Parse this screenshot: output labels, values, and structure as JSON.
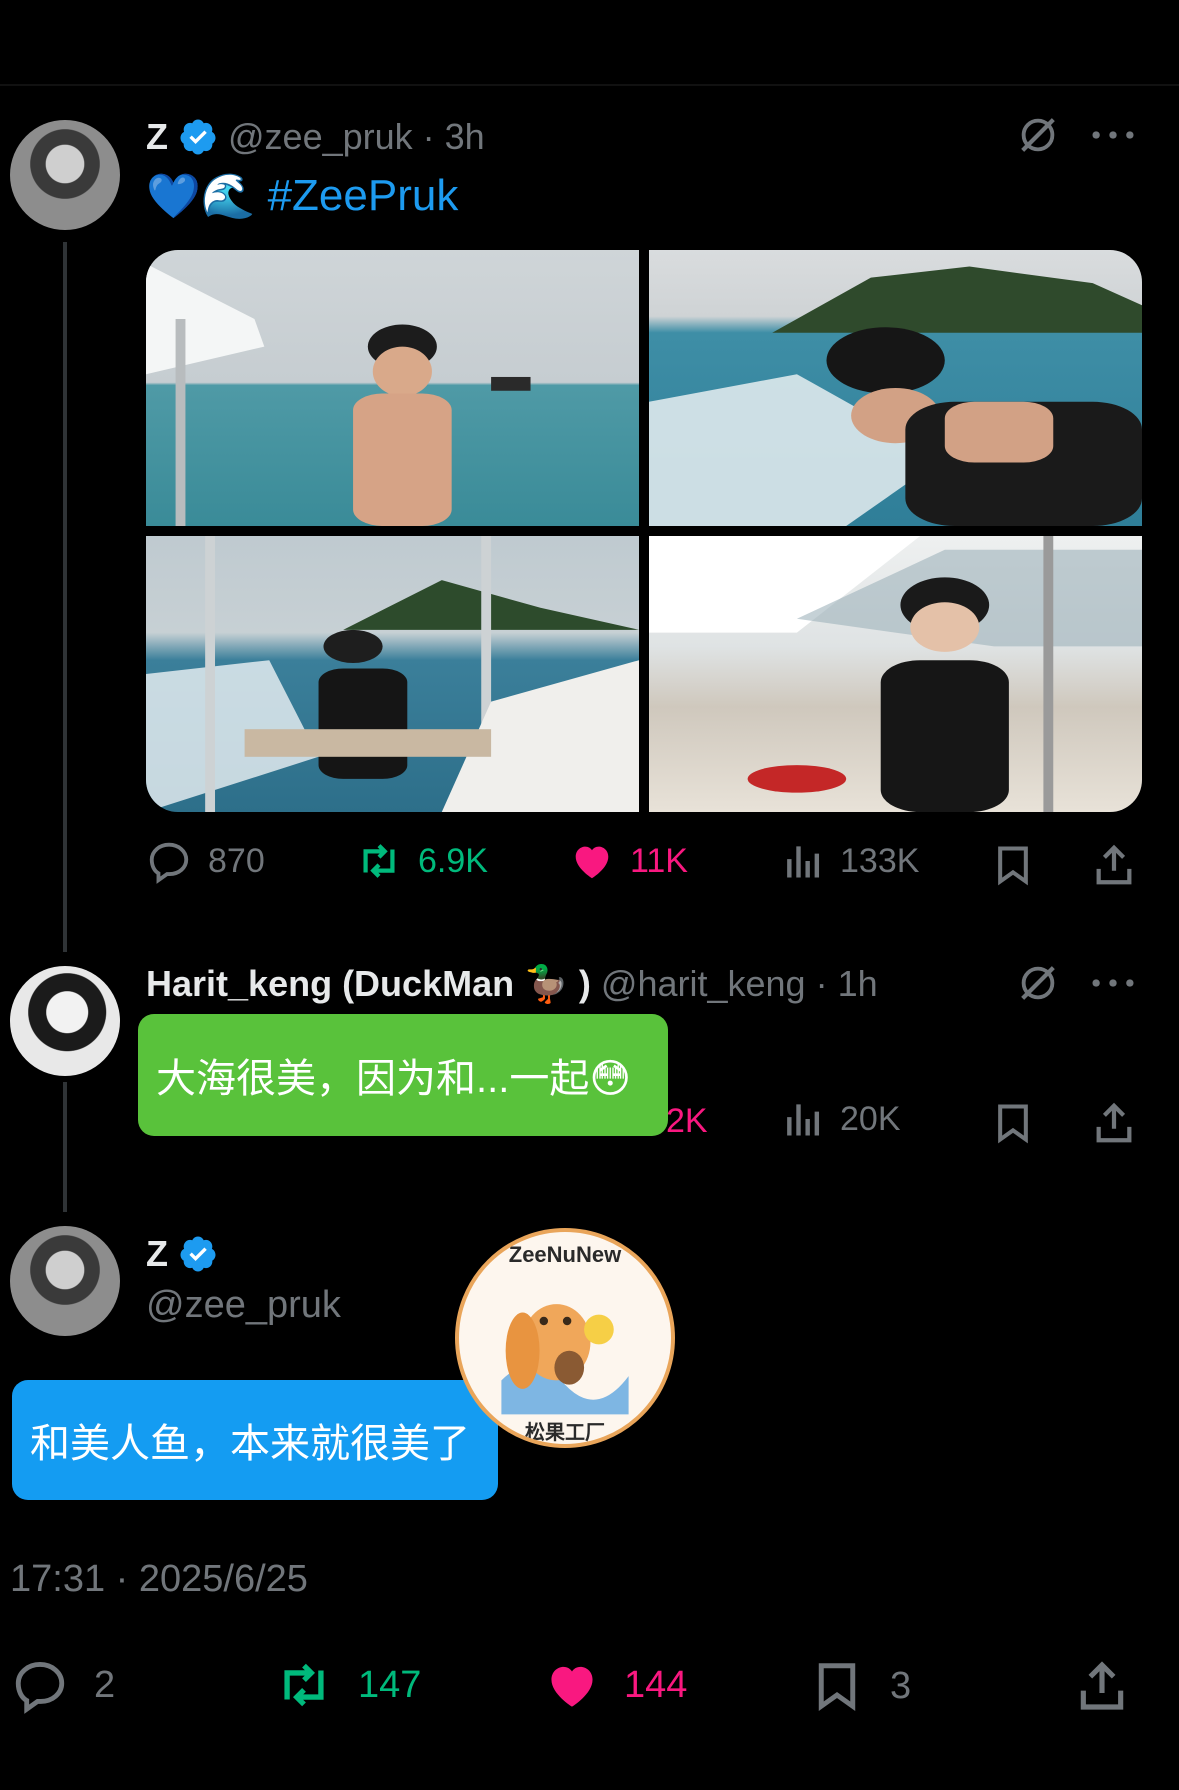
{
  "tweet": {
    "author_name": "Z",
    "author_handle": "@zee_pruk",
    "time_ago": "3h",
    "text_prefix": "💙🌊",
    "hashtag": "#ZeePruk",
    "replies": "870",
    "retweets": "6.9K",
    "likes": "11K",
    "views": "133K"
  },
  "reply1": {
    "author_name": "Harit_keng (DuckMan 🦆 )",
    "author_handle": "@harit_keng",
    "time_ago": "1h",
    "likes_partial": "2K",
    "views": "20K",
    "caption": "大海很美，因为和...一起😳"
  },
  "main": {
    "author_name": "Z",
    "author_handle": "@zee_pruk",
    "caption": "和美人鱼，本来就很美了",
    "timestamp": "17:31 · 2025/6/25",
    "replies": "2",
    "retweets": "147",
    "likes": "144",
    "bookmarks": "3"
  },
  "watermark": {
    "top_text": "ZeeNuNew",
    "bottom_text": "松果工厂"
  },
  "colors": {
    "accent": "#1d9bf0",
    "retweet": "#00ba7c",
    "like": "#f91880",
    "muted": "#71767b"
  }
}
